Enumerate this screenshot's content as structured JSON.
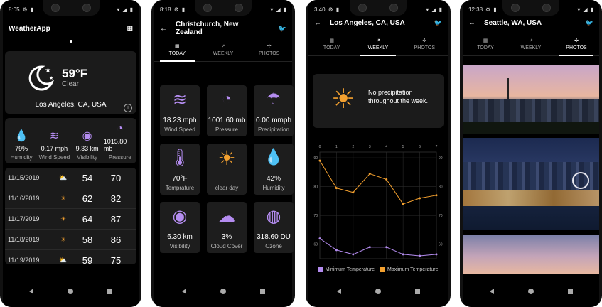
{
  "colors": {
    "accent_purple": "#b48cf0",
    "accent_orange": "#f3a02f",
    "bg": "#000000",
    "card": "#1b1b1b"
  },
  "phone1": {
    "status_time": "8:05",
    "app_title": "WeatherApp",
    "current": {
      "temp": "59°F",
      "condition": "Clear",
      "location": "Los Angeles, CA, USA",
      "icon": "moon-stars-icon"
    },
    "stats": [
      {
        "icon": "droplet-percent-icon",
        "value": "79%",
        "label": "Humidity"
      },
      {
        "icon": "wind-icon",
        "value": "0.17 mph",
        "label": "Wind Speed"
      },
      {
        "icon": "eye-icon",
        "value": "9.33 km",
        "label": "Visibility"
      },
      {
        "icon": "gauge-icon",
        "value": "1015.80 mb",
        "label": "Pressure"
      }
    ],
    "forecast": [
      {
        "date": "11/15/2019",
        "icon": "partly-cloudy-icon",
        "low": "54",
        "high": "70"
      },
      {
        "date": "11/16/2019",
        "icon": "sun-icon",
        "low": "62",
        "high": "82"
      },
      {
        "date": "11/17/2019",
        "icon": "sun-icon",
        "low": "64",
        "high": "87"
      },
      {
        "date": "11/18/2019",
        "icon": "sun-icon",
        "low": "58",
        "high": "86"
      },
      {
        "date": "11/19/2019",
        "icon": "partly-cloudy-icon",
        "low": "59",
        "high": "75"
      }
    ]
  },
  "phone2": {
    "status_time": "8:18",
    "title": "Christchurch, New Zealand",
    "tabs": [
      "TODAY",
      "WEEKLY",
      "PHOTOS"
    ],
    "tiles": [
      {
        "icon": "wind-icon",
        "value": "18.23 mph",
        "label": "Wind Speed"
      },
      {
        "icon": "gauge-icon",
        "value": "1001.60 mb",
        "label": "Pressure"
      },
      {
        "icon": "cloud-rain-icon",
        "value": "0.00 mmph",
        "label": "Precipitation"
      },
      {
        "icon": "thermometer-icon",
        "value": "70°F",
        "label": "Temprature"
      },
      {
        "icon": "sun-icon",
        "value": "",
        "label": "clear day"
      },
      {
        "icon": "droplet-percent-icon",
        "value": "42%",
        "label": "Humidity"
      },
      {
        "icon": "eye-icon",
        "value": "6.30 km",
        "label": "Visibility"
      },
      {
        "icon": "fog-icon",
        "value": "3%",
        "label": "Cloud Cover"
      },
      {
        "icon": "globe-icon",
        "value": "318.60 DU",
        "label": "Ozone"
      }
    ]
  },
  "phone3": {
    "status_time": "3:40",
    "title": "Los Angeles, CA, USA",
    "tabs": [
      "TODAY",
      "WEEKLY",
      "PHOTOS"
    ],
    "summary": "No precipitation throughout the week.",
    "chart_data": {
      "type": "line",
      "x": [
        0,
        1,
        2,
        3,
        4,
        5,
        6,
        7
      ],
      "xticks": [
        "0",
        "1",
        "2",
        "3",
        "4",
        "5",
        "6",
        "7"
      ],
      "ylim": [
        55,
        92
      ],
      "yticks_left": [
        "90",
        "80",
        "70",
        "60"
      ],
      "yticks_right": [
        "90",
        "80",
        "70",
        "60"
      ],
      "series": [
        {
          "name": "Minimum Temperature",
          "color": "#b48cf0",
          "values": [
            62,
            58,
            56.5,
            59,
            59,
            56.5,
            56,
            56.5
          ]
        },
        {
          "name": "Maximum Temperature",
          "color": "#f3a02f",
          "values": [
            89,
            79.5,
            78,
            84.5,
            82.5,
            74,
            76,
            77
          ]
        }
      ]
    }
  },
  "phone4": {
    "status_time": "12:38",
    "title": "Seattle, WA, USA",
    "tabs": [
      "TODAY",
      "WEEKLY",
      "PHOTOS"
    ],
    "photos": [
      "seattle-skyline-photo",
      "seattle-waterfront-photo",
      "seattle-sunset-photo"
    ]
  }
}
